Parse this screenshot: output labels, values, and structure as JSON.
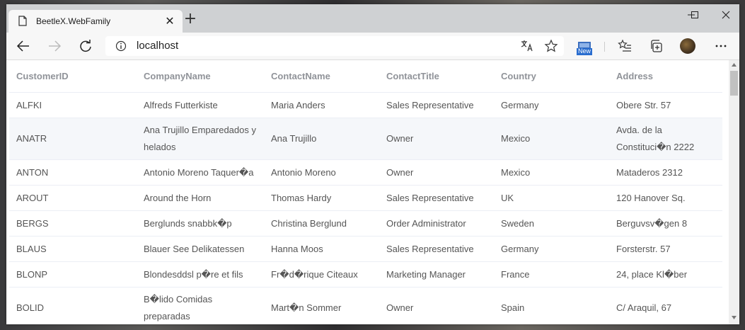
{
  "browser": {
    "tab_title": "BeetleX.WebFamily",
    "url": "localhost",
    "new_badge": "New"
  },
  "table": {
    "headers": [
      "CustomerID",
      "CompanyName",
      "ContactName",
      "ContactTitle",
      "Country",
      "Address"
    ],
    "rows": [
      [
        "ALFKI",
        "Alfreds Futterkiste",
        "Maria Anders",
        "Sales Representative",
        "Germany",
        "Obere Str. 57"
      ],
      [
        "ANATR",
        "Ana Trujillo Emparedados y helados",
        "Ana Trujillo",
        "Owner",
        "Mexico",
        "Avda. de la Constituci�n 2222"
      ],
      [
        "ANTON",
        "Antonio Moreno Taquer�a",
        "Antonio Moreno",
        "Owner",
        "Mexico",
        "Mataderos 2312"
      ],
      [
        "AROUT",
        "Around the Horn",
        "Thomas Hardy",
        "Sales Representative",
        "UK",
        "120 Hanover Sq."
      ],
      [
        "BERGS",
        "Berglunds snabbk�p",
        "Christina Berglund",
        "Order Administrator",
        "Sweden",
        "Berguvsv�gen 8"
      ],
      [
        "BLAUS",
        "Blauer See Delikatessen",
        "Hanna Moos",
        "Sales Representative",
        "Germany",
        "Forsterstr. 57"
      ],
      [
        "BLONP",
        "Blondesddsl p�re et fils",
        "Fr�d�rique Citeaux",
        "Marketing Manager",
        "France",
        "24, place Kl�ber"
      ],
      [
        "BOLID",
        "B�lido Comidas preparadas",
        "Mart�n Sommer",
        "Owner",
        "Spain",
        "C/ Araquil, 67"
      ]
    ]
  }
}
